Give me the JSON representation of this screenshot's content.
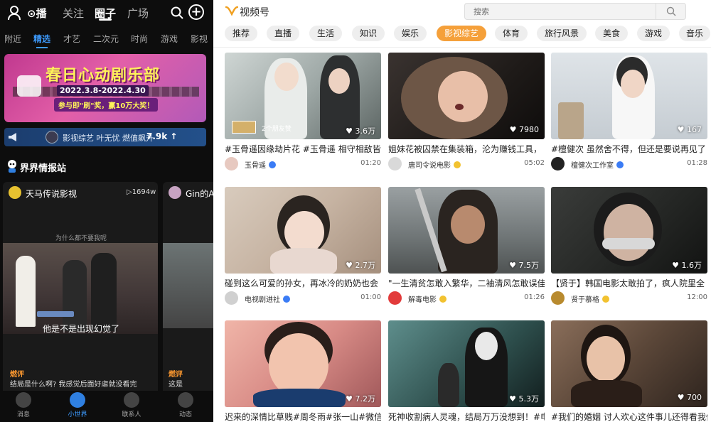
{
  "left": {
    "topnav": {
      "items": [
        "关注",
        "圈子",
        "广场"
      ],
      "active": 1
    },
    "subtabs": [
      "附近",
      "精选",
      "才艺",
      "二次元",
      "时尚",
      "游戏",
      "影视"
    ],
    "subtab_active": 1,
    "banner": {
      "title": "春日心动剧乐部",
      "date": "2022.3.8-2022.4.30",
      "subtitle": "参与即\"刷\"奖，赢10万大奖！"
    },
    "hotbar": {
      "text": "影视综艺  叶无忧  燃值飙升",
      "value": "7.9k ↑"
    },
    "section_title": "界界情报站",
    "card1": {
      "name": "天马传说影视",
      "plays": "▷1694w",
      "question": "为什么都不要我呢",
      "subtitle": "他是不是出现幻觉了",
      "comment_label": "燃评",
      "comment": "结局是什么啊? 我感觉后面好虐就没看完"
    },
    "card2": {
      "name": "Gin的A",
      "comment_label": "燃评",
      "comment": "这是"
    },
    "bottomnav": [
      "消息",
      "小世界",
      "联系人",
      "动态"
    ],
    "bottom_active": 1
  },
  "right": {
    "logo": "视频号",
    "search": {
      "placeholder": "搜索"
    },
    "categories": [
      "推荐",
      "直播",
      "生活",
      "知识",
      "娱乐",
      "影视综艺",
      "体育",
      "旅行风景",
      "美食",
      "游戏",
      "音乐"
    ],
    "active_category": 5,
    "videos": [
      {
        "title": "#玉骨遥因缘劫片花 #玉骨遥 相守相敌皆徒",
        "author": "玉骨遥",
        "likes": "♥ 3.6万",
        "duration": "01:20",
        "friends": "2个朋友赞",
        "badge": "#3b7cf5"
      },
      {
        "title": "姐妹花被囚禁在集装箱，沦为赚钱工具，",
        "author": "唐司令说电影",
        "likes": "♥ 7980",
        "duration": "05:02",
        "badge": "#f2c230"
      },
      {
        "title": "#檀健次 虽然舍不得，但还是要说再见了",
        "author": "檀健次工作室",
        "likes": "♥ 167",
        "duration": "01:28",
        "badge": "#3b7cf5"
      },
      {
        "title": "碰到这么可爱的孙女，再冰冷的奶奶也会",
        "author": "电视剧进社",
        "likes": "♥ 2.7万",
        "duration": "01:00",
        "badge": "#3b7cf5"
      },
      {
        "title": "\"一生清贫怎敢入繁华，二袖清风怎敢误佳",
        "author": "解毒电影",
        "likes": "♥ 7.5万",
        "duration": "01:26",
        "badge": "#f2c230"
      },
      {
        "title": "【贤于】韩国电影太敢拍了，疯人院里全",
        "author": "贤于慕格",
        "likes": "♥ 1.6万",
        "duration": "12:00",
        "badge": "#f2c230"
      },
      {
        "title": "迟来的深情比草贱#周冬雨#张一山#微信影",
        "author": "",
        "likes": "♥ 7.2万",
        "duration": "",
        "badge": ""
      },
      {
        "title": "死神收割病人灵魂，结局万万没想到！#电",
        "author": "",
        "likes": "♥ 5.3万",
        "duration": "",
        "badge": ""
      },
      {
        "title": "#我们的婚姻 讨人欢心这件事儿还得看我们",
        "author": "",
        "likes": "♥ 700",
        "duration": "",
        "badge": ""
      }
    ]
  },
  "colors": {
    "accent": "#f5a03a",
    "left_bg": "#0d0d0d",
    "active_blue": "#3d9bff"
  }
}
